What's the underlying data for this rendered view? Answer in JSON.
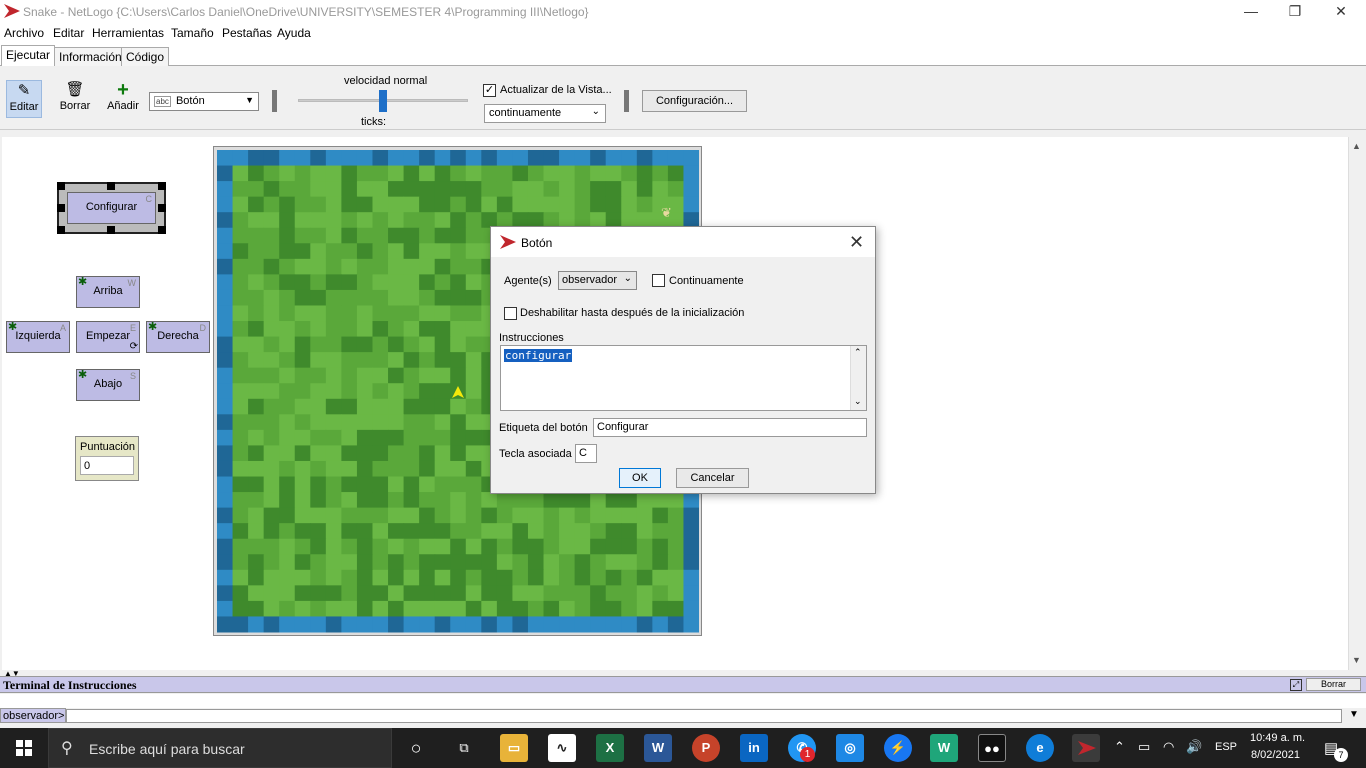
{
  "window": {
    "title": "Snake - NetLogo {C:\\Users\\Carlos Daniel\\OneDrive\\UNIVERSITY\\SEMESTER 4\\Programming III\\Netlogo}",
    "minimize": "—",
    "restore": "❐",
    "close": "✕"
  },
  "menu": [
    "Archivo",
    "Editar",
    "Herramientas",
    "Tamaño",
    "Pestañas",
    "Ayuda"
  ],
  "tabs": [
    "Ejecutar",
    "Información",
    "Código"
  ],
  "toolbar": {
    "edit": "Editar",
    "delete": "Borrar",
    "add": "Añadir",
    "widget_type": "Botón",
    "widget_icon_text": "abc",
    "speed_label": "velocidad normal",
    "speed_value": 0.5,
    "ticks_label": "ticks:",
    "update_view_label": "Actualizar de la Vista...",
    "update_view_checked": true,
    "update_mode": "continuamente",
    "settings": "Configuración..."
  },
  "widgets": {
    "setup": {
      "label": "Configurar",
      "key": "C"
    },
    "up": {
      "label": "Arriba",
      "key": "W"
    },
    "left": {
      "label": "Izquierda",
      "key": "A"
    },
    "go": {
      "label": "Empezar",
      "key": "E"
    },
    "right": {
      "label": "Derecha",
      "key": "D"
    },
    "down": {
      "label": "Abajo",
      "key": "S"
    },
    "score": {
      "label": "Puntuación",
      "value": "0"
    }
  },
  "colors": {
    "grass_light": "#6ab845",
    "grass_mid": "#5aa83a",
    "grass_dark": "#3f8a2c",
    "water": "#2f8bc5",
    "water_dark": "#1f6796",
    "button_bg": "#bdbbe4",
    "accent": "#1e6fc8"
  },
  "dialog": {
    "title": "Botón",
    "agents_label": "Agente(s)",
    "agents_value": "observador",
    "forever_label": "Continuamente",
    "forever_checked": false,
    "disable_label": "Deshabilitar hasta después de la inicialización",
    "disable_checked": false,
    "commands_label": "Instrucciones",
    "commands_value": "configurar",
    "display_name_label": "Etiqueta del botón",
    "display_name_value": "Configurar",
    "action_key_label": "Tecla asociada",
    "action_key_value": "C",
    "ok": "OK",
    "cancel": "Cancelar"
  },
  "terminal": {
    "title": "Terminal de Instrucciones",
    "clear": "Borrar",
    "prompt": "observador>"
  },
  "taskbar": {
    "search_placeholder": "Escribe aquí para buscar",
    "time": "10:49 a. m.",
    "date": "8/02/2021",
    "lang": "ESP",
    "notification_badge": "1",
    "action_center_count": "7"
  }
}
